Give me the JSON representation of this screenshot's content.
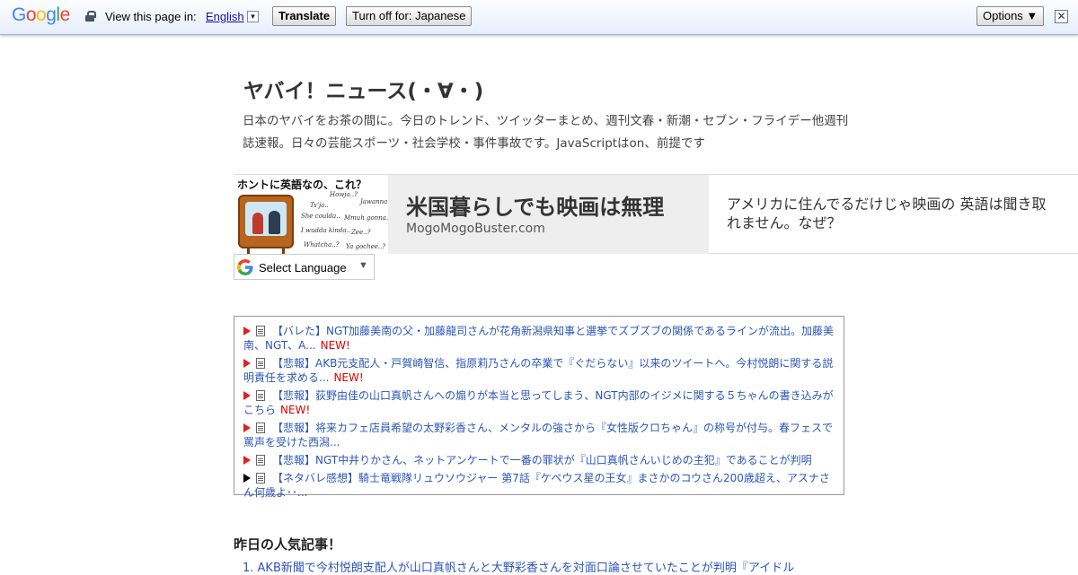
{
  "translate_bar": {
    "logo": [
      "G",
      "o",
      "o",
      "g",
      "l",
      "e"
    ],
    "view_text": "View this page in:",
    "language": "English",
    "language_arrow": "▼",
    "translate_label": "Translate",
    "turn_off_label": "Turn off for: Japanese",
    "options_label": "Options ▼",
    "close_label": "✕"
  },
  "blog": {
    "title": "ヤバイ！ニュース(・∀・)",
    "description": "日本のヤバイをお茶の間に。今日のトレンド、ツイッターまとめ、週刊文春・新潮・セブン・フライデー他週刊誌速報。日々の芸能スポーツ・社会学校・事件事故です。JavaScriptはon、前提です"
  },
  "ad": {
    "image_title": "ホントに英語なの、これ？",
    "image_phrases": [
      "Howja..?",
      "Jawanna..?",
      "Tsʼja..",
      "She coulda..",
      "Mmuh gonna..",
      "I wudda kinda..",
      "Zee..?",
      "Whatcha..?",
      "Ya gochee..?"
    ],
    "headline": "米国暮らしでも映画は無理",
    "url": "MogoMogoBuster.com",
    "body": "アメリカに住んでるだけじゃ映画の 英語は聞き取れません。なぜ？"
  },
  "language_select": {
    "label": "Select Language",
    "arrow": "▼"
  },
  "rss": [
    {
      "text": "【バレた】NGT加藤美南の父・加藤龍司さんが花角新潟県知事と選挙でズブズブの関係であるラインが流出。加藤美南、NGT、A...",
      "new": "NEW!",
      "arrow": "red"
    },
    {
      "text": "【悲報】AKB元支配人・戸賀崎智信、指原莉乃さんの卒業で『ぐだらない』以来のツイートへ。今村悦朗に関する説明責任を求める...",
      "new": "NEW!",
      "arrow": "red"
    },
    {
      "text": "【悲報】荻野由佳の山口真帆さんへの煽りが本当と思ってしまう、NGT内部のイジメに関する５ちゃんの書き込みがこちら",
      "new": "NEW!",
      "arrow": "red"
    },
    {
      "text": "【悲報】将来カフェ店員希望の太野彩香さん、メンタルの強さから『女性版クロちゃん』の称号が付与。春フェスで罵声を受けた西潟...",
      "new": "",
      "arrow": "red"
    },
    {
      "text": "【悲報】NGT中井りかさん、ネットアンケートで一番の罪状が『山口真帆さんいじめの主犯』であることが判明",
      "new": "",
      "arrow": "red"
    },
    {
      "text": "【ネタバレ感想】騎士竜戦隊リュウソウジャー 第7話『ケペウス星の王女』まさかのコウさん200歳超え、アスナさん何歳よ･･...",
      "new": "",
      "arrow": "black"
    }
  ],
  "popular": {
    "heading": "昨日の人気記事！",
    "first_item": "1. AKB新聞で今村悦朗支配人が山口真帆さんと大野彩香さんを対面口論させていたことが判明『アイドル"
  },
  "colors": {
    "link": "#2a56b8",
    "new_badge": "#e00000",
    "arrow_red": "#e02020",
    "ad_mid_bg": "#eeeeee"
  }
}
